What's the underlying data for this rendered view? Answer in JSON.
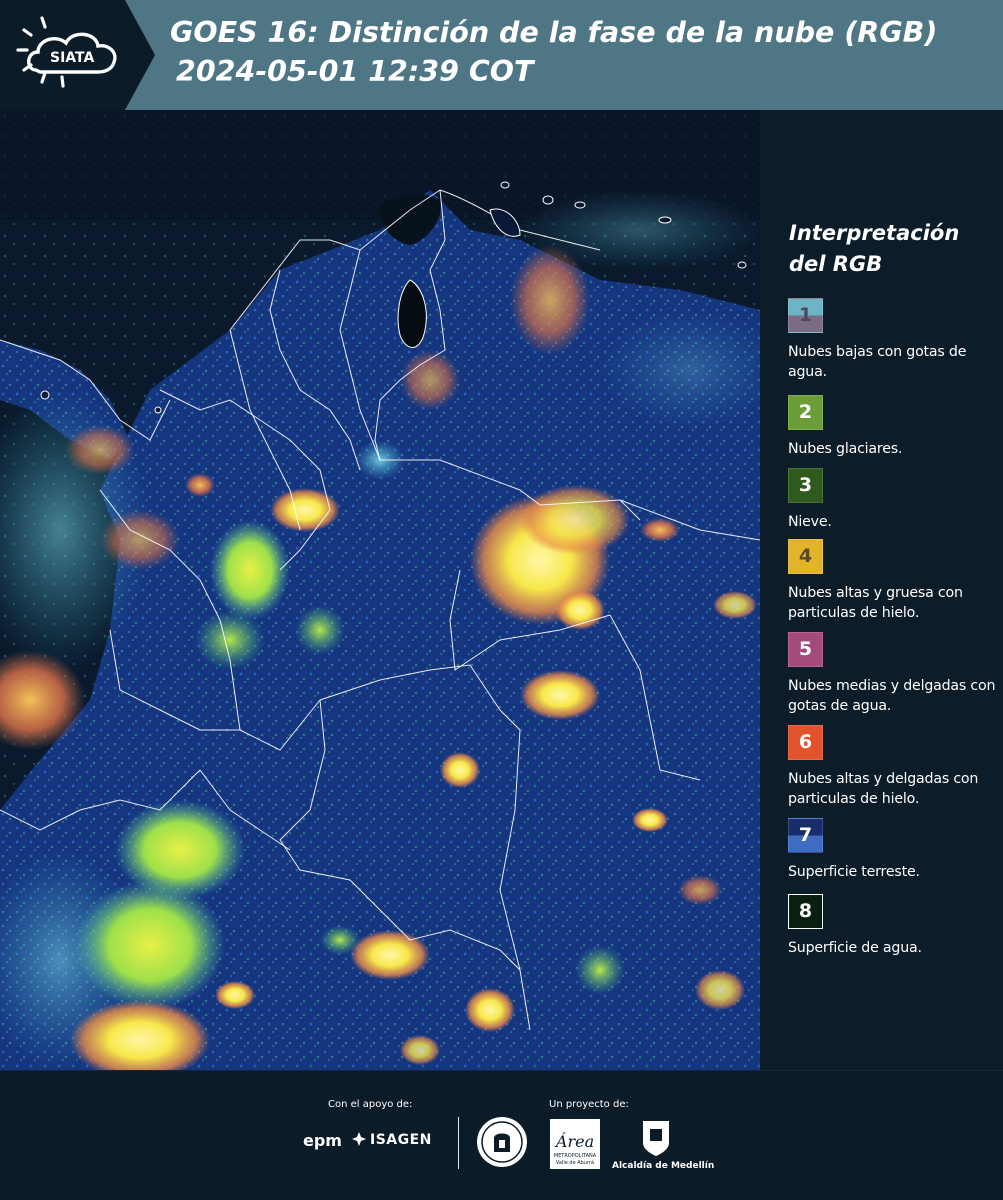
{
  "header": {
    "logo_text": "SIATA",
    "title_line1": "GOES 16: Distinción de la fase de la nube (RGB)",
    "title_line2": "2024-05-01 12:39 COT"
  },
  "legend": {
    "title": "Interpretación del RGB",
    "items": [
      {
        "number": "1",
        "label": "Nubes bajas con gotas de agua.",
        "color_top": "#6fb3c6",
        "color_bottom": "#7b6c86",
        "text_color": "#4a4a5a"
      },
      {
        "number": "2",
        "label": "Nubes glaciares.",
        "color_top": "#6b9e36",
        "color_bottom": "#6b9e36",
        "text_color": "#ffffff"
      },
      {
        "number": "3",
        "label": "Nieve.",
        "color_top": "#2f5a1d",
        "color_bottom": "#2f5a1d",
        "text_color": "#ffffff"
      },
      {
        "number": "4",
        "label": "Nubes altas y gruesa con particulas de hielo.",
        "color_top": "#e2b42a",
        "color_bottom": "#e2b42a",
        "text_color": "#5a4a20"
      },
      {
        "number": "5",
        "label": "Nubes medias y delgadas con gotas de agua.",
        "color_top": "#a54b7b",
        "color_bottom": "#a54b7b",
        "text_color": "#ffffff"
      },
      {
        "number": "6",
        "label": "Nubes altas y delgadas con particulas de hielo.",
        "color_top": "#e0532b",
        "color_bottom": "#e0532b",
        "text_color": "#ffffff"
      },
      {
        "number": "7",
        "label": "Superficie terreste.",
        "color_top": "#1a2c6b",
        "color_bottom": "#3e6cc2",
        "text_color": "#ffffff"
      },
      {
        "number": "8",
        "label": "Superficie de agua.",
        "color_top": "#0b1f10",
        "color_bottom": "#0b1f10",
        "text_color": "#ffffff"
      }
    ]
  },
  "footer": {
    "support_label": "Con el apoyo de:",
    "project_label": "Un proyecto de:",
    "sponsor_1": "epm",
    "sponsor_2": "ISAGEN",
    "partner_1": "Área Metropolitana Valle de Aburrá",
    "partner_1_mark": "Área",
    "partner_1_sub": "METROPOLITANA",
    "partner_1_sub2": "Valle de Aburrá",
    "partner_2": "Alcaldía de Medellín"
  },
  "map": {
    "description_colors": {
      "ocean": "#081522",
      "land": "#13317a",
      "cloud_low": "#4fc3d9",
      "cloud_high": "#f4e34a",
      "cloud_thin": "#e9734a",
      "borders": "#ffffff"
    }
  }
}
